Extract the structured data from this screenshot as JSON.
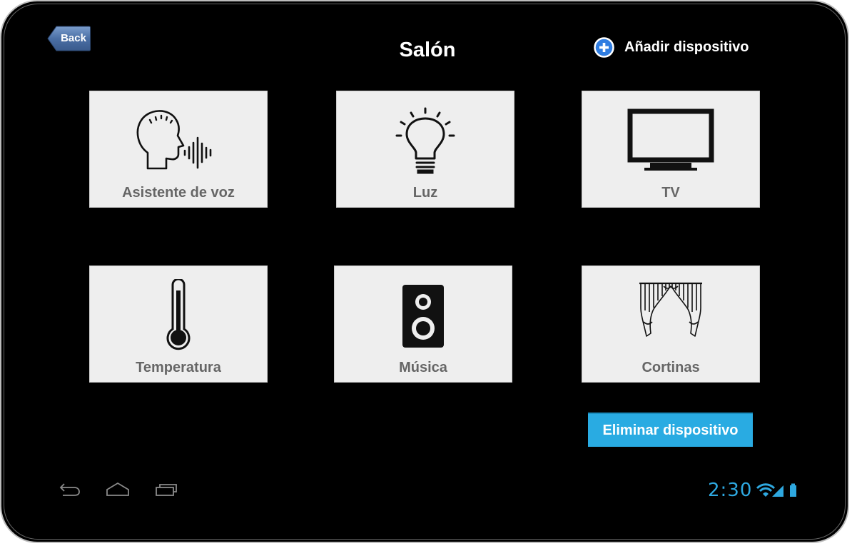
{
  "header": {
    "back_label": "Back",
    "title": "Salón",
    "add_device_label": "Añadir dispositivo"
  },
  "devices": [
    {
      "label": "Asistente de voz",
      "icon": "voice-assistant-icon"
    },
    {
      "label": "Luz",
      "icon": "light-bulb-icon"
    },
    {
      "label": "TV",
      "icon": "tv-icon"
    },
    {
      "label": "Temperatura",
      "icon": "thermometer-icon"
    },
    {
      "label": "Música",
      "icon": "speaker-icon"
    },
    {
      "label": "Cortinas",
      "icon": "curtains-icon"
    }
  ],
  "actions": {
    "delete_device_label": "Eliminar dispositivo"
  },
  "status_bar": {
    "time": "2:30",
    "icons": [
      "wifi-icon",
      "signal-icon",
      "battery-icon"
    ]
  },
  "nav_bar": {
    "icons": [
      "back-nav-icon",
      "home-nav-icon",
      "recent-apps-icon"
    ]
  },
  "colors": {
    "background": "#000000",
    "tile": "#eeeeee",
    "tile_label": "#666666",
    "accent": "#29abe2",
    "back_button": "#4a6fa5"
  }
}
